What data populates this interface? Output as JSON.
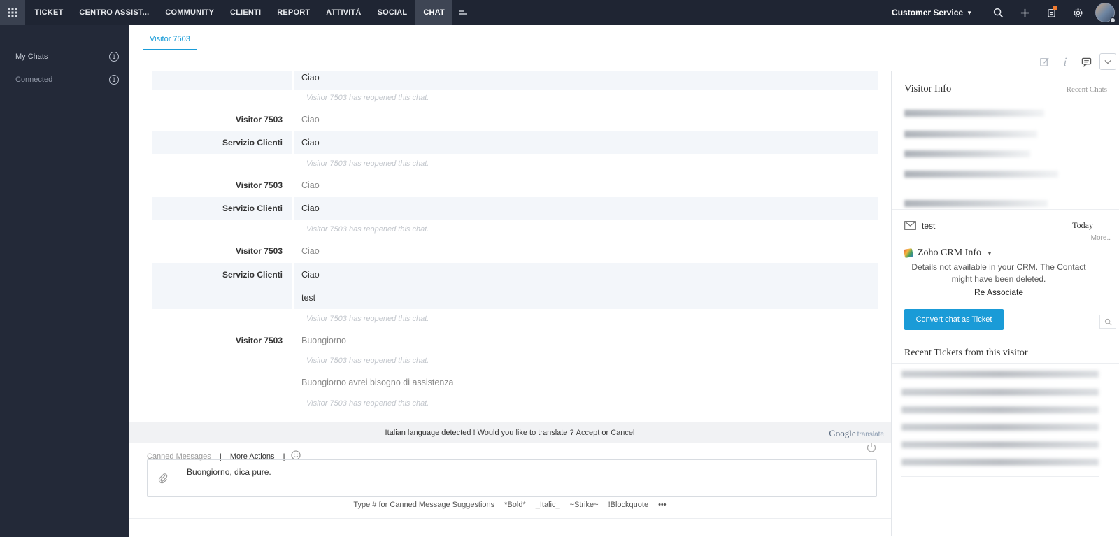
{
  "topnav": {
    "items": [
      {
        "label": "TICKET"
      },
      {
        "label": "CENTRO ASSIST..."
      },
      {
        "label": "COMMUNITY"
      },
      {
        "label": "CLIENTI"
      },
      {
        "label": "REPORT"
      },
      {
        "label": "ATTIVITÀ"
      },
      {
        "label": "SOCIAL"
      },
      {
        "label": "CHAT"
      }
    ],
    "active": "CHAT",
    "department": "Customer Service",
    "icons": [
      "apps-grid-icon",
      "more-menu-icon",
      "search-icon",
      "plus-icon",
      "notification-icon",
      "settings-icon",
      "avatar"
    ]
  },
  "sidebar": {
    "items": [
      {
        "label": "My Chats",
        "count": "1"
      },
      {
        "label": "Connected",
        "count": "1"
      }
    ]
  },
  "tab": {
    "label": "Visitor 7503"
  },
  "transcript": [
    {
      "type": "agent",
      "sender": "",
      "text": "Ciao"
    },
    {
      "type": "sys",
      "text": "Visitor 7503 has reopened this chat."
    },
    {
      "type": "visitor",
      "sender": "Visitor 7503",
      "text": "Ciao"
    },
    {
      "type": "agent",
      "sender": "Servizio Clienti",
      "text": "Ciao"
    },
    {
      "type": "sys",
      "text": "Visitor 7503 has reopened this chat."
    },
    {
      "type": "visitor",
      "sender": "Visitor 7503",
      "text": "Ciao"
    },
    {
      "type": "agent",
      "sender": "Servizio Clienti",
      "text": "Ciao"
    },
    {
      "type": "sys",
      "text": "Visitor 7503 has reopened this chat."
    },
    {
      "type": "visitor",
      "sender": "Visitor 7503",
      "text": "Ciao"
    },
    {
      "type": "agent",
      "sender": "Servizio Clienti",
      "text": "Ciao"
    },
    {
      "type": "agent",
      "sender": "",
      "text": "test"
    },
    {
      "type": "sys",
      "text": "Visitor 7503 has reopened this chat."
    },
    {
      "type": "visitor",
      "sender": "Visitor 7503",
      "text": "Buongiorno"
    },
    {
      "type": "sys",
      "text": "Visitor 7503 has reopened this chat."
    },
    {
      "type": "visitor",
      "sender": "",
      "text": "Buongiorno avrei bisogno di assistenza"
    },
    {
      "type": "sys",
      "text": "Visitor 7503 has reopened this chat."
    }
  ],
  "translate": {
    "prefix": "Italian language detected ! Would you like to translate ?",
    "accept": "Accept",
    "or": "or",
    "cancel": "Cancel",
    "brand_google": "Google",
    "brand_translate": "translate"
  },
  "composer": {
    "canned": "Canned Messages",
    "more_actions": "More Actions",
    "text": "Buongiorno, dica pure.",
    "hints": [
      "Type # for Canned Message Suggestions",
      "*Bold*",
      "_Italic_",
      "~Strike~",
      "!Blockquote",
      "•••"
    ]
  },
  "right_panel": {
    "title": "Visitor Info",
    "recent_chats": "Recent Chats",
    "mail_subject": "test",
    "mail_date": "Today",
    "more": "More..",
    "crm_title": "Zoho CRM Info",
    "crm_note": "Details not available in your CRM. The Contact might have been deleted.",
    "reassociate": "Re Associate",
    "convert_button": "Convert chat as Ticket",
    "recent_tickets_title": "Recent Tickets from this visitor"
  },
  "colors": {
    "topnav_bg": "#1f2533",
    "sidebar_bg": "#232938",
    "accent": "#1a9bd7"
  }
}
